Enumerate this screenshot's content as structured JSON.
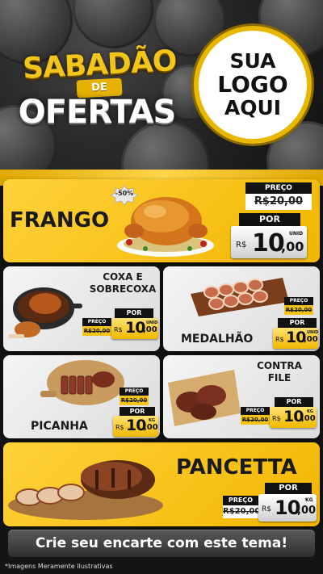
{
  "header": {
    "title_line1": "SABADÃO",
    "title_line2": "DE",
    "title_line3": "OFERTAS",
    "logo_placeholder": [
      "SUA",
      "LOGO",
      "AQUI"
    ]
  },
  "products": [
    {
      "name": "FRANGO",
      "badge": "-50%",
      "price_label": "PREÇO",
      "old_price": "R$20,00",
      "por_label": "POR",
      "currency": "R$",
      "price_int": "10",
      "price_cents": ",00",
      "unit": "UNID"
    },
    {
      "name_lines": [
        "COXA E",
        "SOBRECOXA"
      ],
      "price_label": "PREÇO",
      "old_price": "R$20,00",
      "por_label": "POR",
      "currency": "R$",
      "price_int": "10",
      "price_cents": ",00",
      "unit": "UNID"
    },
    {
      "name": "MEDALHÃO",
      "price_label": "PREÇO",
      "old_price": "R$20,00",
      "por_label": "POR",
      "currency": "R$",
      "price_int": "10",
      "price_cents": ",00",
      "unit": "UNID"
    },
    {
      "name": "PICANHA",
      "price_label": "PREÇO",
      "old_price": "R$20,00",
      "por_label": "POR",
      "currency": "R$",
      "price_int": "10",
      "price_cents": ",00",
      "unit": "KG"
    },
    {
      "name_lines": [
        "CONTRA",
        "FILE"
      ],
      "price_label": "PREÇO",
      "old_price": "R$20,00",
      "por_label": "POR",
      "currency": "R$",
      "price_int": "10",
      "price_cents": ",00",
      "unit": "KG"
    },
    {
      "name": "PANCETTA",
      "price_label": "PREÇO",
      "old_price": "R$20,00",
      "por_label": "POR",
      "currency": "R$",
      "price_int": "10",
      "price_cents": ",00",
      "unit": "KG"
    }
  ],
  "footer": {
    "cta": "Crie seu encarte com este tema!",
    "disclaimer": "*Imagens Meramente Ilustrativas"
  },
  "colors": {
    "accent": "#f2b600",
    "dark": "#121212",
    "card_white": "#eeeeee"
  }
}
